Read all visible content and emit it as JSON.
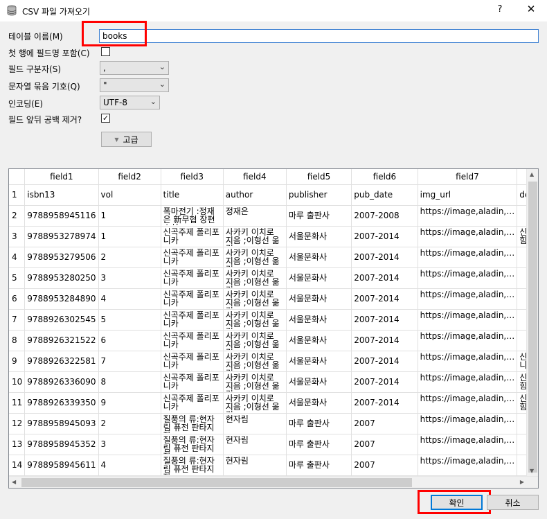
{
  "window": {
    "title": "CSV 파일 가져오기",
    "help": "?",
    "close": "✕"
  },
  "form": {
    "table_name_label": "테이블 이름(M)",
    "table_name_value": "books",
    "first_row_label": "첫 행에 필드명 포함(C)",
    "first_row_checked": "",
    "separator_label": "필드 구분자(S)",
    "separator_value": ",",
    "quote_label": "문자열 묶음 기호(Q)",
    "quote_value": "\"",
    "encoding_label": "인코딩(E)",
    "encoding_value": "UTF-8",
    "trim_label": "필드 앞뒤 공백 제거?",
    "trim_checked": "✓",
    "advanced_label": "고급"
  },
  "grid": {
    "columns": [
      "field1",
      "field2",
      "field3",
      "field4",
      "field5",
      "field6",
      "field7",
      ""
    ],
    "header_row": {
      "num": "1",
      "cells": [
        "isbn13",
        "vol",
        "title",
        "author",
        "publisher",
        "pub_date",
        "img_url",
        "des"
      ]
    },
    "rows": [
      {
        "num": "2",
        "cells": [
          "9788958945116",
          "1",
          "폭마전기 :정재은 新무협 장편소설",
          "정재은",
          "마루 출판사",
          "2007-2008",
          "https://image,aladin,…",
          ""
        ]
      },
      {
        "num": "3",
        "cells": [
          "9788953278974",
          "1",
          "신곡주제 폴리포니카",
          "사카키 이치로 지음 ;이형선 옮김",
          "서울문화사",
          "2007-2014",
          "https://image,aladin,…",
          "신곡 힘을"
        ]
      },
      {
        "num": "4",
        "cells": [
          "9788953279506",
          "2",
          "신곡주제 폴리포니카",
          "사카키 이치로 지음 ;이형선 옮김",
          "서울문화사",
          "2007-2014",
          "https://image,aladin,…",
          ""
        ]
      },
      {
        "num": "5",
        "cells": [
          "9788953280250",
          "3",
          "신곡주제 폴리포니카",
          "사카키 이치로 지음 ;이형선 옮김",
          "서울문화사",
          "2007-2014",
          "https://image,aladin,…",
          ""
        ]
      },
      {
        "num": "6",
        "cells": [
          "9788953284890",
          "4",
          "신곡주제 폴리포니카",
          "사카키 이치로 지음 ;이형선 옮김",
          "서울문화사",
          "2007-2014",
          "https://image,aladin,…",
          ""
        ]
      },
      {
        "num": "7",
        "cells": [
          "9788926302545",
          "5",
          "신곡주제 폴리포니카",
          "사카키 이치로 지음 ;이형선 옮김",
          "서울문화사",
          "2007-2014",
          "https://image,aladin,…",
          ""
        ]
      },
      {
        "num": "8",
        "cells": [
          "9788926321522",
          "6",
          "신곡주제 폴리포니카",
          "사카키 이치로 지음 ;이형선 옮김",
          "서울문화사",
          "2007-2014",
          "https://image,aladin,…",
          ""
        ]
      },
      {
        "num": "9",
        "cells": [
          "9788926322581",
          "7",
          "신곡주제 폴리포니카",
          "사카키 이치로 지음 ;이형선 옮김",
          "서울문화사",
          "2007-2014",
          "https://image,aladin,…",
          "신곡 니카"
        ]
      },
      {
        "num": "10",
        "cells": [
          "9788926336090",
          "8",
          "신곡주제 폴리포니카",
          "사카키 이치로 지음 ;이형선 옮김",
          "서울문화사",
          "2007-2014",
          "https://image,aladin,…",
          "신곡 힘을"
        ]
      },
      {
        "num": "11",
        "cells": [
          "9788926339350",
          "9",
          "신곡주제 폴리포니카",
          "사카키 이치로 지음 ;이형선 옮김",
          "서울문화사",
          "2007-2014",
          "https://image,aladin,…",
          "신곡 힘을"
        ]
      },
      {
        "num": "12",
        "cells": [
          "9788958945093",
          "2",
          "질풍의 류:현자림 퓨전 판타지 장…",
          "현자림",
          "마루 출판사",
          "2007",
          "https://image,aladin,…",
          ""
        ]
      },
      {
        "num": "13",
        "cells": [
          "9788958945352",
          "3",
          "질풍의 류:현자림 퓨전 판타지 장…",
          "현자림",
          "마루 출판사",
          "2007",
          "https://image,aladin,…",
          ""
        ]
      },
      {
        "num": "14",
        "cells": [
          "9788958945611",
          "4",
          "질풍의 류:현자림 퓨전 판타지 장…",
          "현자림",
          "마루 출판사",
          "2007",
          "https://image,aladin,…",
          ""
        ]
      }
    ]
  },
  "buttons": {
    "ok": "확인",
    "cancel": "취소"
  }
}
